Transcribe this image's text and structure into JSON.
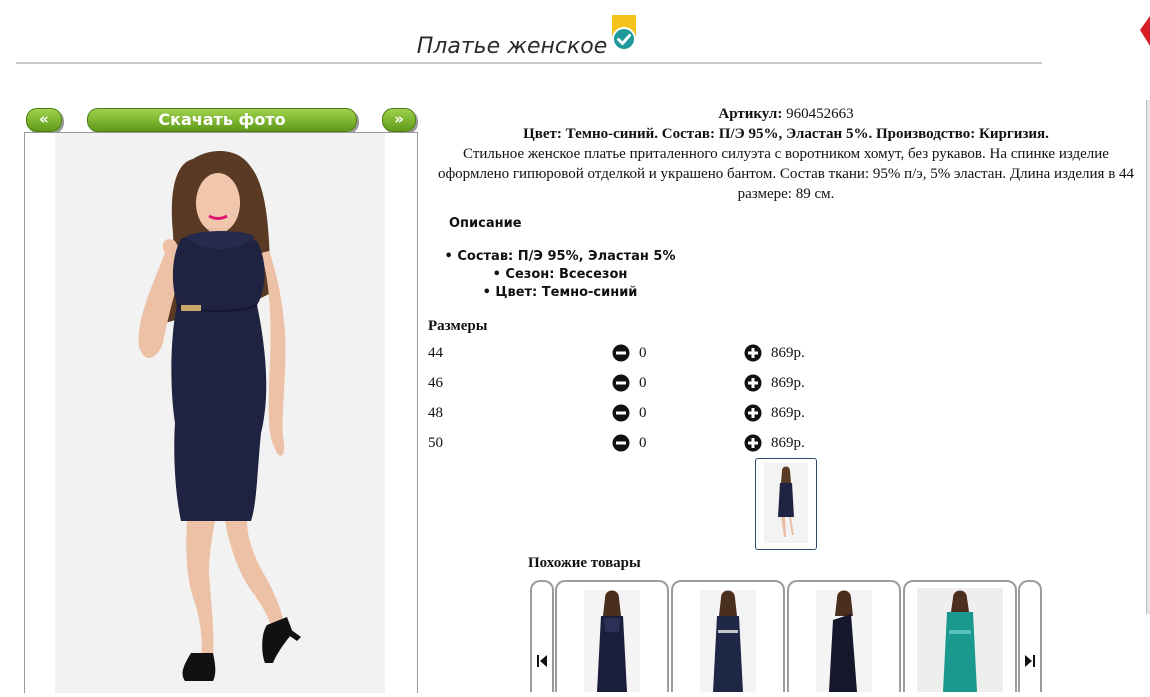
{
  "header": {
    "title": "Платье женское"
  },
  "gallery": {
    "prev_label": "«",
    "next_label": "»",
    "download_label": "Скачать фото"
  },
  "product": {
    "article_label": "Артикул:",
    "article_value": "960452663",
    "composition_line": "Цвет: Темно-синий. Состав: П/Э 95%, Эластан 5%. Производство: Киргизия.",
    "description": "Стильное женское платье приталенного силуэта с воротником хомут, без рукавов. На спинке изделие оформлено гипюровой отделкой и украшено бантом. Состав ткани: 95% п/э, 5% эластан. Длина изделия в 44 размере: 89 см.",
    "specs_title": "Описание",
    "specs": [
      "Состав: П/Э 95%, Эластан 5%",
      "Сезон: Всесезон",
      "Цвет: Темно-синий"
    ]
  },
  "sizes": {
    "title": "Размеры",
    "rows": [
      {
        "size": "44",
        "qty": "0",
        "price": "869р."
      },
      {
        "size": "46",
        "qty": "0",
        "price": "869р."
      },
      {
        "size": "48",
        "qty": "0",
        "price": "869р."
      },
      {
        "size": "50",
        "qty": "0",
        "price": "869р."
      }
    ]
  },
  "similar": {
    "title": "Похожие товары"
  },
  "colors": {
    "accent_green": "#6aa321",
    "dress_navy": "#1f2240",
    "teal_dress": "#1a9a8e",
    "badge_yellow": "#f5c21b",
    "badge_teal": "#1e9a9a"
  },
  "icons": {
    "badge": "verified-check-icon",
    "minus": "minus-circle-icon",
    "plus": "plus-circle-icon",
    "carousel_prev": "skip-back-icon",
    "carousel_next": "skip-forward-icon"
  }
}
